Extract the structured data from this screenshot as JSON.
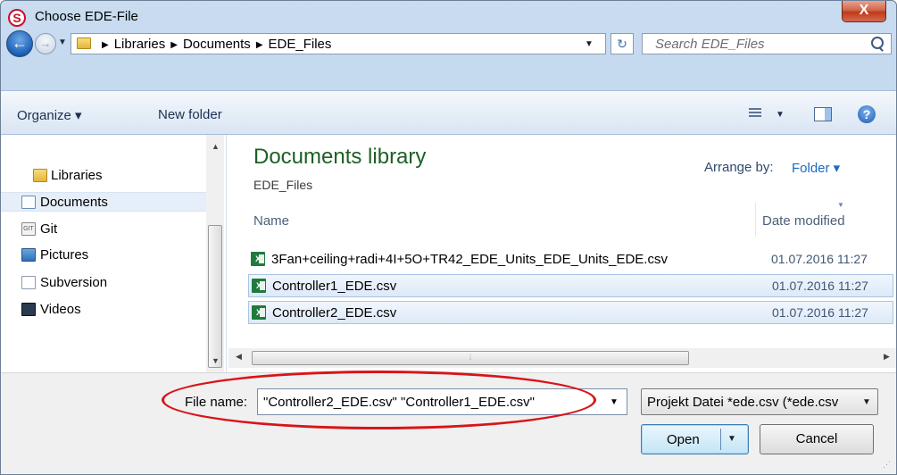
{
  "window": {
    "title": "Choose EDE-File",
    "close_label": "X"
  },
  "address": {
    "crumbs": [
      "Libraries",
      "Documents",
      "EDE_Files"
    ],
    "search_placeholder": "Search EDE_Files"
  },
  "toolbar": {
    "organize_label": "Organize ▾",
    "new_folder_label": "New folder"
  },
  "nav": {
    "items": [
      {
        "label": "Libraries",
        "icon": "library-icon"
      },
      {
        "label": "Documents",
        "icon": "documents-icon",
        "selected": true
      },
      {
        "label": "Git",
        "icon": "git-icon"
      },
      {
        "label": "Pictures",
        "icon": "pictures-icon"
      },
      {
        "label": "Subversion",
        "icon": "subversion-icon"
      },
      {
        "label": "Videos",
        "icon": "videos-icon"
      }
    ]
  },
  "content": {
    "library_title": "Documents library",
    "library_subtitle": "EDE_Files",
    "arrange_label": "Arrange by:",
    "arrange_value": "Folder ▾",
    "columns": {
      "name": "Name",
      "date": "Date modified"
    },
    "files": [
      {
        "name": "3Fan+ceiling+radi+4I+5O+TR42_EDE_Units_EDE_Units_EDE.csv",
        "date": "01.07.2016 11:27",
        "selected": false
      },
      {
        "name": "Controller1_EDE.csv",
        "date": "01.07.2016 11:27",
        "selected": true
      },
      {
        "name": "Controller2_EDE.csv",
        "date": "01.07.2016 11:27",
        "selected": true
      }
    ]
  },
  "footer": {
    "file_name_label": "File name:",
    "file_name_value": "\"Controller2_EDE.csv\" \"Controller1_EDE.csv\"",
    "file_type_value": "Projekt Datei *ede.csv (*ede.csv",
    "open_label": "Open",
    "cancel_label": "Cancel"
  },
  "colors": {
    "library_title": "#1e5f25",
    "annotation_ellipse": "#d9141a",
    "selection": "#dde9f8"
  }
}
